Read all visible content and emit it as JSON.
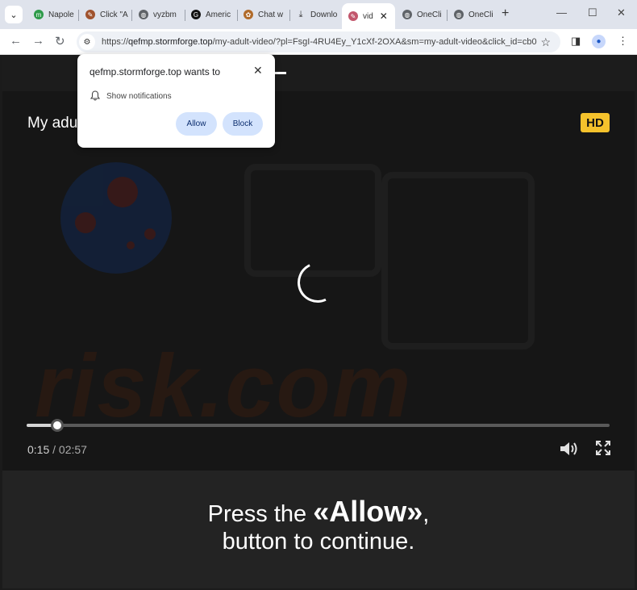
{
  "browser": {
    "tabs": [
      {
        "label": "Napole",
        "fav_color": "#2e9b4a",
        "fav_glyph": "m"
      },
      {
        "label": "Click \"A",
        "fav_color": "#a0522d",
        "fav_glyph": "✎"
      },
      {
        "label": "vyzbm",
        "fav_color": "#5f6368",
        "fav_glyph": "◍"
      },
      {
        "label": "Americ",
        "fav_color": "#111111",
        "fav_glyph": "G"
      },
      {
        "label": "Chat w",
        "fav_color": "#b06a2a",
        "fav_glyph": "✿"
      },
      {
        "label": "Downlo",
        "fav_color": "#5f6368",
        "fav_glyph": "⤓"
      },
      {
        "label": "vid",
        "fav_color": "#c2566c",
        "fav_glyph": "✎"
      },
      {
        "label": "OneCli",
        "fav_color": "#5f6368",
        "fav_glyph": "◍"
      },
      {
        "label": "OneCli",
        "fav_color": "#5f6368",
        "fav_glyph": "◍"
      }
    ],
    "new_tab_icon": "plus-icon",
    "url_host": "qefmp.stormforge.top",
    "url_rest": "/my-adult-video/?pl=FsgI-4RU4Ey_Y1cXf-2OXA&sm=my-adult-video&click_id=cb0...",
    "url_scheme": "https://"
  },
  "permission_popup": {
    "title": "qefmp.stormforge.top wants to",
    "item": "Show notifications",
    "allow_label": "Allow",
    "block_label": "Block"
  },
  "video": {
    "title": "My adult",
    "hd_badge": "HD",
    "current_time": "0:15",
    "separator": "/",
    "duration": "02:57",
    "progress_fraction": 0.0525
  },
  "watermark": {
    "text": "risk.com"
  },
  "cta": {
    "prefix": "Press the ",
    "emphasis": "«Allow»",
    "suffix": ",",
    "line2": "button to continue."
  },
  "colors": {
    "hd_badge": "#f5c22c",
    "popup_button": "#d3e3fd"
  }
}
